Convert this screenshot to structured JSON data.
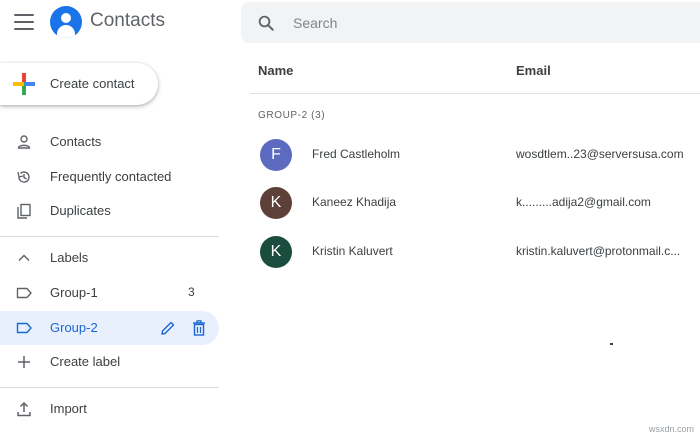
{
  "header": {
    "app_title": "Contacts",
    "search_placeholder": "Search"
  },
  "sidebar": {
    "create_label": "Create contact",
    "items": [
      {
        "label": "Contacts",
        "icon": "person-icon"
      },
      {
        "label": "Frequently contacted",
        "icon": "history-icon"
      },
      {
        "label": "Duplicates",
        "icon": "duplicate-icon"
      }
    ],
    "labels_section": {
      "label": "Labels",
      "icon": "chevron-up-icon"
    },
    "labels": [
      {
        "label": "Group-1",
        "count": "3",
        "active": false
      },
      {
        "label": "Group-2",
        "active": true
      }
    ],
    "create_label_item": "Create label",
    "import_label": "Import"
  },
  "main": {
    "columns": {
      "name": "Name",
      "email": "Email"
    },
    "group_heading": "GROUP-2 (3)",
    "contacts": [
      {
        "initial": "F",
        "name": "Fred Castleholm",
        "email": "wosdtlem..23@serversusa.com",
        "color": "#5c6bc0"
      },
      {
        "initial": "K",
        "name": "Kaneez Khadija",
        "email": "k.........adija2@gmail.com",
        "color": "#5d4037"
      },
      {
        "initial": "K",
        "name": "Kristin Kaluvert",
        "email": "kristin.kaluvert@protonmail.c...",
        "color": "#1b4d3e"
      }
    ]
  },
  "colors": {
    "accent": "#1a73e8",
    "active_bg": "#e8f0fe",
    "active_text": "#1967d2",
    "search_bg": "#f1f3f4"
  },
  "watermark": "wsxdn.com"
}
